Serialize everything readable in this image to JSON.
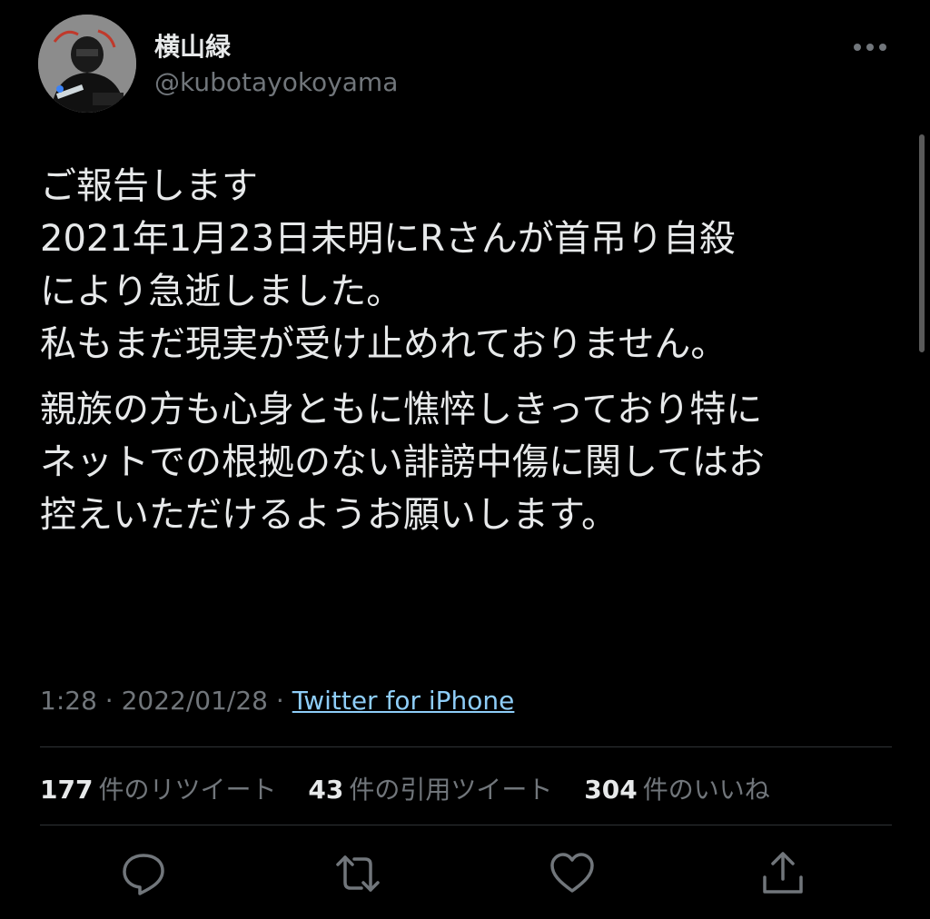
{
  "author": {
    "display_name": "横山緑",
    "handle": "@kubotayokoyama",
    "avatar_icon": "avatar-icon"
  },
  "tweet": {
    "paragraphs": [
      [
        "ご報告します",
        "2021年1月23日未明にRさんが首吊り自殺",
        "により急逝しました。",
        "私もまだ現実が受け止めれておりません。"
      ],
      [
        "親族の方も心身ともに憔悴しきっており特に",
        "ネットでの根拠のない誹謗中傷に関してはお",
        "控えいただけるようお願いします。"
      ]
    ]
  },
  "meta": {
    "time": "1:28",
    "date": "2022/01/28",
    "separator": "·",
    "source": "Twitter for iPhone"
  },
  "stats": {
    "retweets": {
      "count": "177",
      "label": "件のリツイート"
    },
    "quotes": {
      "count": "43",
      "label": "件の引用ツイート"
    },
    "likes": {
      "count": "304",
      "label": "件のいいね"
    }
  },
  "actions": {
    "reply_icon": "reply-icon",
    "retweet_icon": "retweet-icon",
    "like_icon": "heart-icon",
    "share_icon": "share-icon"
  },
  "colors": {
    "background": "#000000",
    "text": "#e7e9ea",
    "secondary": "#71767b",
    "link": "#8ecdf8",
    "divider": "#2f3336"
  }
}
